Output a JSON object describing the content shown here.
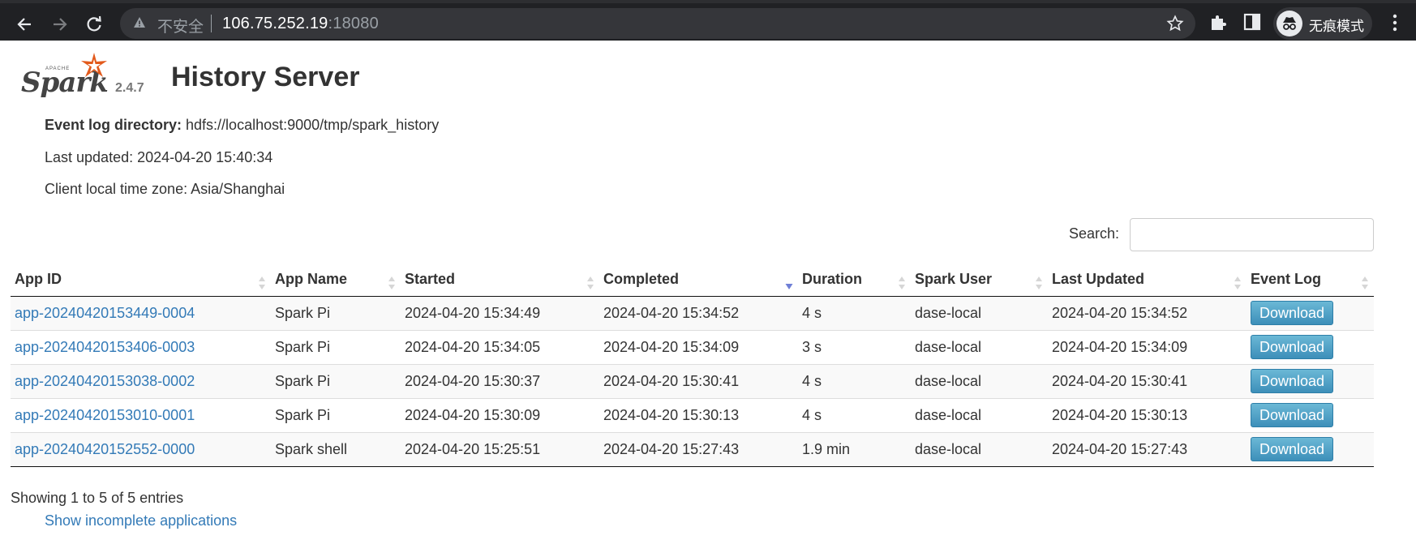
{
  "browser": {
    "insecure_label": "不安全",
    "url_host": "106.75.252.19",
    "url_port": ":18080",
    "incognito_label": "无痕模式"
  },
  "page": {
    "logo_text": "Spark",
    "logo_apache": "APACHE",
    "version": "2.4.7",
    "title": "History Server",
    "event_log_label": "Event log directory:",
    "event_log_value": " hdfs://localhost:9000/tmp/spark_history",
    "last_updated": "Last updated: 2024-04-20 15:40:34",
    "timezone": "Client local time zone: Asia/Shanghai",
    "search_label": "Search:",
    "search_value": "",
    "showing": "Showing 1 to 5 of 5 entries",
    "incomplete_link": "Show incomplete applications"
  },
  "table": {
    "columns": [
      "App ID",
      "App Name",
      "Started",
      "Completed",
      "Duration",
      "Spark User",
      "Last Updated",
      "Event Log"
    ],
    "sorted_column": "Completed",
    "sort_direction": "desc",
    "rows": [
      {
        "app_id": "app-20240420153449-0004",
        "app_name": "Spark Pi",
        "started": "2024-04-20 15:34:49",
        "completed": "2024-04-20 15:34:52",
        "duration": "4 s",
        "user": "dase-local",
        "last_updated": "2024-04-20 15:34:52",
        "event_log": "Download"
      },
      {
        "app_id": "app-20240420153406-0003",
        "app_name": "Spark Pi",
        "started": "2024-04-20 15:34:05",
        "completed": "2024-04-20 15:34:09",
        "duration": "3 s",
        "user": "dase-local",
        "last_updated": "2024-04-20 15:34:09",
        "event_log": "Download"
      },
      {
        "app_id": "app-20240420153038-0002",
        "app_name": "Spark Pi",
        "started": "2024-04-20 15:30:37",
        "completed": "2024-04-20 15:30:41",
        "duration": "4 s",
        "user": "dase-local",
        "last_updated": "2024-04-20 15:30:41",
        "event_log": "Download"
      },
      {
        "app_id": "app-20240420153010-0001",
        "app_name": "Spark Pi",
        "started": "2024-04-20 15:30:09",
        "completed": "2024-04-20 15:30:13",
        "duration": "4 s",
        "user": "dase-local",
        "last_updated": "2024-04-20 15:30:13",
        "event_log": "Download"
      },
      {
        "app_id": "app-20240420152552-0000",
        "app_name": "Spark shell",
        "started": "2024-04-20 15:25:51",
        "completed": "2024-04-20 15:27:43",
        "duration": "1.9 min",
        "user": "dase-local",
        "last_updated": "2024-04-20 15:27:43",
        "event_log": "Download"
      }
    ]
  },
  "colors": {
    "link": "#337ab7",
    "chrome_bg": "#202124",
    "button": "#3d8fb9",
    "sort_active": "#6f7fd6"
  }
}
